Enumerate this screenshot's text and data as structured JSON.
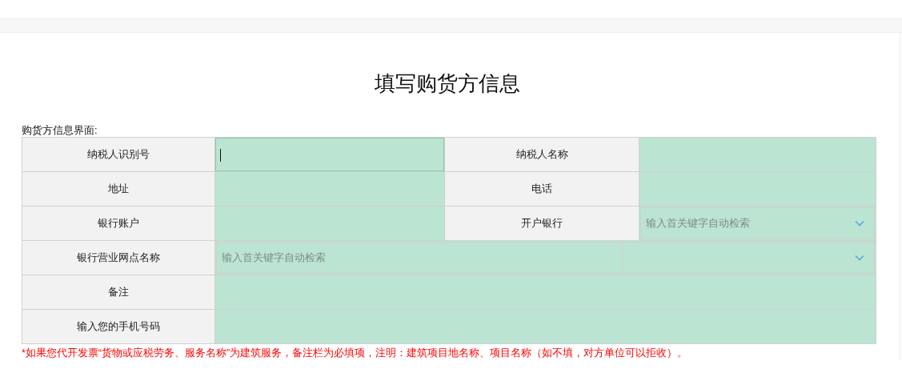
{
  "title": "填写购货方信息",
  "section_label": "购货方信息界面:",
  "rows": [
    {
      "cells": [
        {
          "label": "纳税人识别号",
          "field": {
            "kind": "text",
            "focused": true
          }
        },
        {
          "label": "纳税人名称",
          "field": {
            "kind": "text",
            "focused": false
          }
        }
      ]
    },
    {
      "cells": [
        {
          "label": "地址",
          "field": {
            "kind": "text",
            "focused": false
          }
        },
        {
          "label": "电话",
          "field": {
            "kind": "text",
            "focused": false
          }
        }
      ]
    },
    {
      "cells": [
        {
          "label": "银行账户",
          "field": {
            "kind": "text",
            "focused": false
          }
        },
        {
          "label": "开户银行",
          "field": {
            "kind": "combo",
            "placeholder": "输入首关键字自动检索"
          }
        }
      ]
    },
    {
      "cells": [
        {
          "label": "银行营业网点名称",
          "field": {
            "kind": "combo",
            "placeholder": "输入首关键字自动检索"
          }
        }
      ]
    },
    {
      "cells": [
        {
          "label": "备注",
          "field": {
            "kind": "text",
            "focused": false
          }
        }
      ]
    },
    {
      "cells": [
        {
          "label": "输入您的手机号码",
          "field": {
            "kind": "text",
            "focused": false
          }
        }
      ]
    }
  ],
  "note": "*如果您代开发票“货物或应税劳务、服务名称”为建筑服务，备注栏为必填项，注明：建筑项目地名称、项目名称（如不填，对方单位可以拒收）。"
}
